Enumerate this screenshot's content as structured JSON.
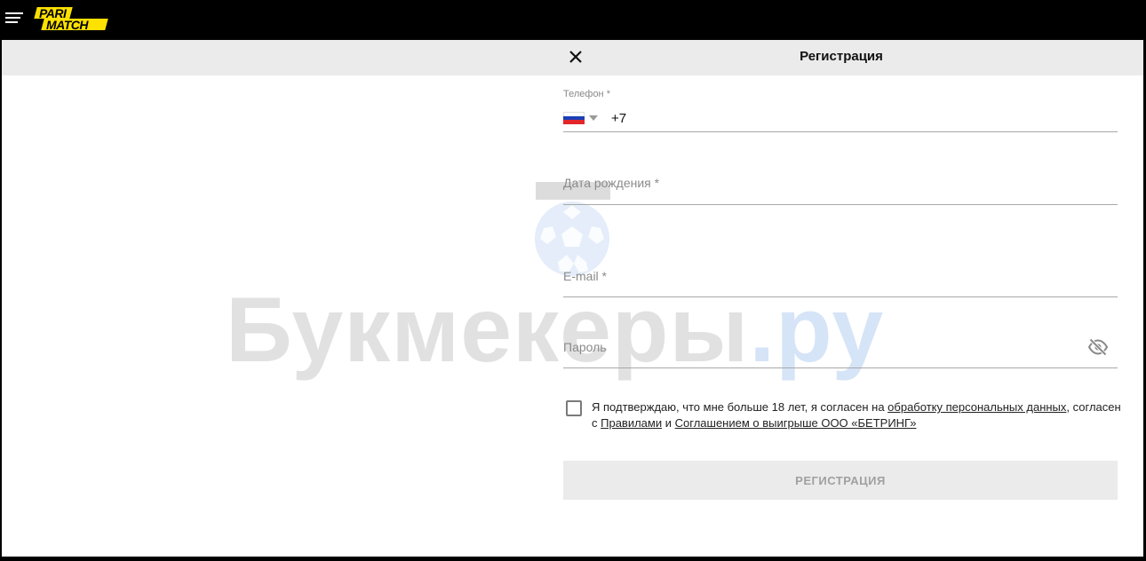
{
  "brand": {
    "logo_line1": "PARI",
    "logo_line2": "MATCH",
    "yellow": "#fde100"
  },
  "menu_icon": "hamburger-icon",
  "modal": {
    "title": "Регистрация",
    "close_icon": "close-icon"
  },
  "phone": {
    "label": "Телефон *",
    "country_flag": "russia-flag-icon",
    "value": "+7"
  },
  "dob": {
    "placeholder": "Дата рождения *"
  },
  "email": {
    "placeholder": "E-mail *"
  },
  "password": {
    "placeholder": "Пароль",
    "toggle_icon": "eye-off-icon"
  },
  "consent": {
    "text1": "Я подтверждаю, что мне больше 18 лет, я согласен на ",
    "link1": "обработку персональных данных",
    "text2": ", согласен с ",
    "link2": "Правилами",
    "text3": " и ",
    "link3": "Соглашением о выигрыше ООО «БЕТРИНГ»",
    "checked": false
  },
  "submit_label": "РЕГИСТРАЦИЯ",
  "watermark": {
    "main": "Букмекеры",
    "suffix": ".ру"
  }
}
